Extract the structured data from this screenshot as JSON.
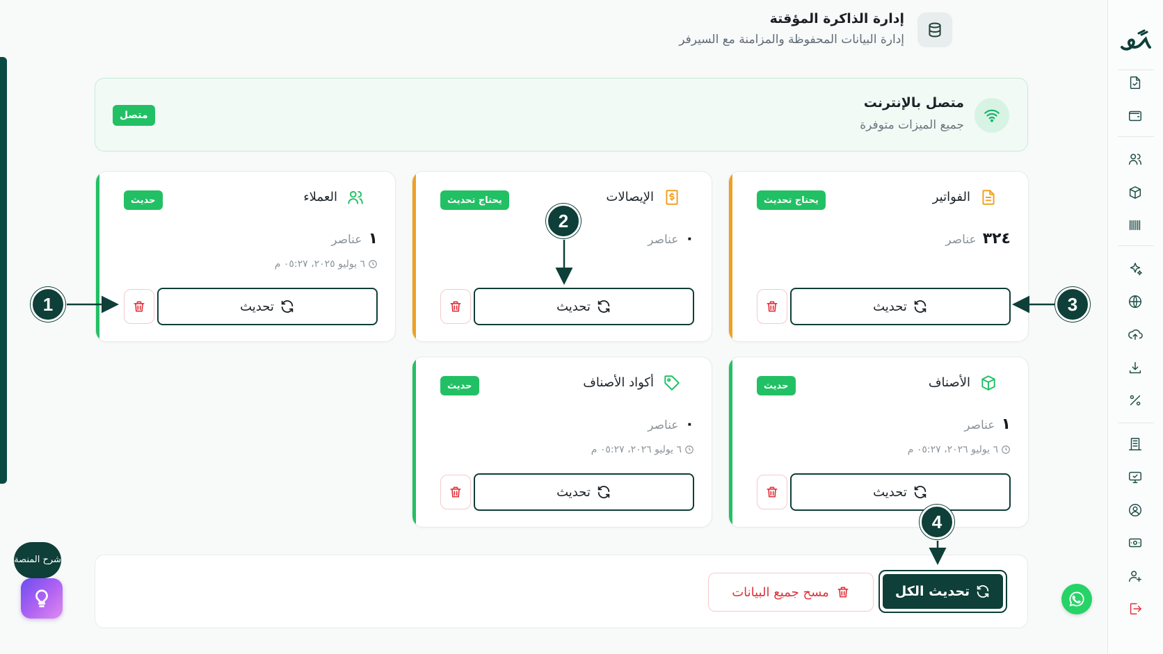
{
  "header": {
    "title": "إدارة الذاكرة المؤقتة",
    "subtitle": "إدارة البيانات المحفوظة والمزامنة مع السيرفر",
    "icon": "database-icon"
  },
  "connection": {
    "title": "متصل بالإنترنت",
    "subtitle": "جميع الميزات متوفرة",
    "badge": "متصل",
    "icon": "wifi-icon",
    "color": "#22c064"
  },
  "cards": [
    {
      "title": "الفواتير",
      "icon": "invoice-icon",
      "badge": "يحتاج تحديث",
      "badge_color": "#22c064",
      "accent": "#f0a020",
      "count": "٣٢٤",
      "unit": "عناصر",
      "time": "",
      "refresh_label": "تحديث"
    },
    {
      "title": "الإيصالات",
      "icon": "receipt-icon",
      "badge": "يحتاج تحديث",
      "badge_color": "#22c064",
      "accent": "#f0a020",
      "count": "٠",
      "unit": "عناصر",
      "time": "",
      "refresh_label": "تحديث"
    },
    {
      "title": "العملاء",
      "icon": "users-icon",
      "badge": "حديث",
      "badge_color": "#22c064",
      "accent": "#22c064",
      "count": "١",
      "unit": "عناصر",
      "time": "٦ يوليو ٢٠٢٥، ٠٥:٢٧ م",
      "refresh_label": "تحديث"
    },
    {
      "title": "الأصناف",
      "icon": "box-icon",
      "badge": "حديث",
      "badge_color": "#22c064",
      "accent": "#22c064",
      "count": "١",
      "unit": "عناصر",
      "time": "٦ يوليو ٢٠٢٦، ٠٥:٢٧ م",
      "refresh_label": "تحديث"
    },
    {
      "title": "أكواد الأصناف",
      "icon": "tag-icon",
      "badge": "حديث",
      "badge_color": "#22c064",
      "accent": "#22c064",
      "count": "٠",
      "unit": "عناصر",
      "time": "٦ يوليو ٢٠٢٦، ٠٥:٢٧ م",
      "refresh_label": "تحديث"
    }
  ],
  "actions": {
    "refresh_all": "تحديث الكل",
    "clear_all": "مسح جميع البيانات"
  },
  "markers": [
    "1",
    "2",
    "3",
    "4"
  ],
  "help": {
    "label": "شرح المنصة"
  },
  "sidebar": {
    "icons": [
      "file-check-icon",
      "wallet-icon",
      "users-icon",
      "package-icon",
      "barcode-icon",
      "sparkle-icon",
      "globe-icon",
      "cloud-upload-icon",
      "download-icon",
      "percent-icon",
      "building-icon",
      "monitor-check-icon",
      "user-circle-icon",
      "cash-icon",
      "user-plus-icon",
      "logout-icon"
    ]
  },
  "colors": {
    "primary": "#0e3f38",
    "success": "#22c064",
    "warning": "#f0a020",
    "danger": "#e0323c"
  }
}
